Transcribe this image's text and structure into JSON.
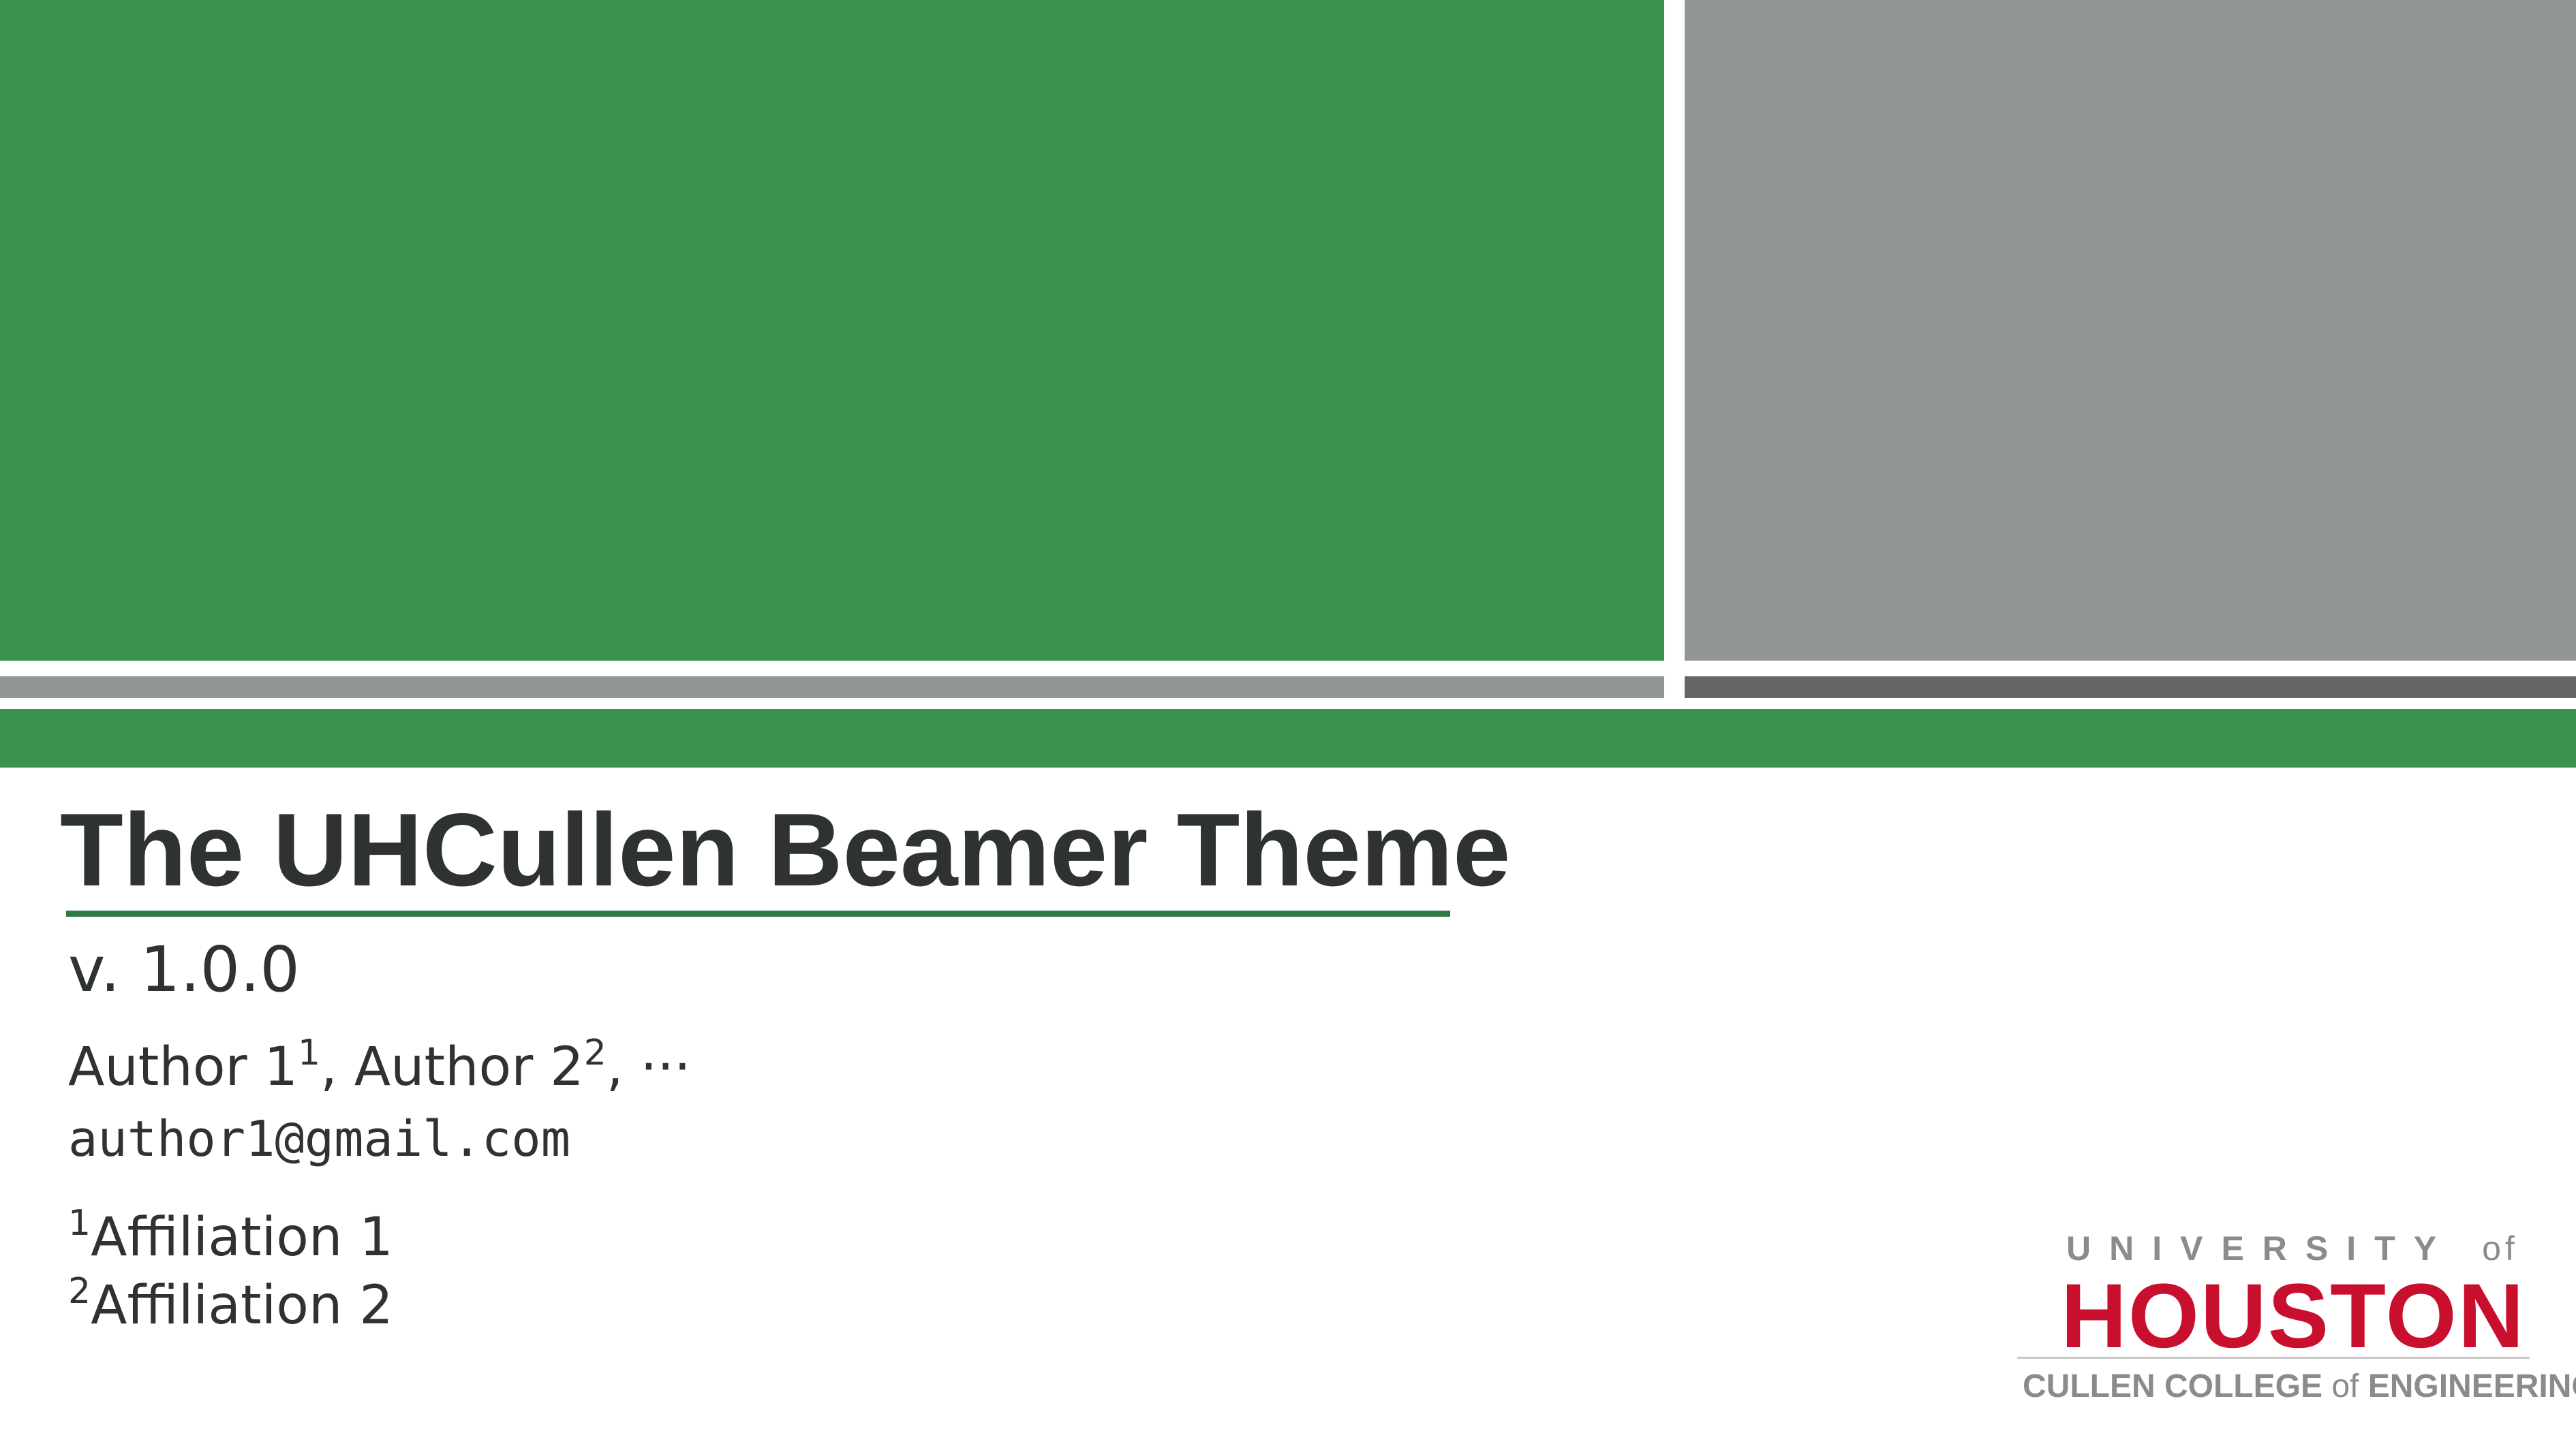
{
  "theme": {
    "green": "#3a924f",
    "gray": "#939793",
    "dark_gray": "#666666",
    "text": "#2e332f",
    "uh_red": "#c8102e"
  },
  "slide": {
    "title": "The UHCullen Beamer Theme",
    "version": "v. 1.0.0",
    "authors": [
      {
        "name": "Author 1",
        "affil": "1"
      },
      {
        "name": "Author 2",
        "affil": "2"
      }
    ],
    "authors_ellipsis": "···",
    "email": "author1@gmail.com",
    "affiliations": [
      {
        "mark": "1",
        "name": "Affiliation 1"
      },
      {
        "mark": "2",
        "name": "Affiliation 2"
      }
    ]
  },
  "logo": {
    "university": "UNIVERSITY",
    "of": "of",
    "houston": "HOUSTON",
    "college_pre": "CULLEN COLLEGE ",
    "college_of": "of",
    "college_post": " ENGINEERING"
  }
}
